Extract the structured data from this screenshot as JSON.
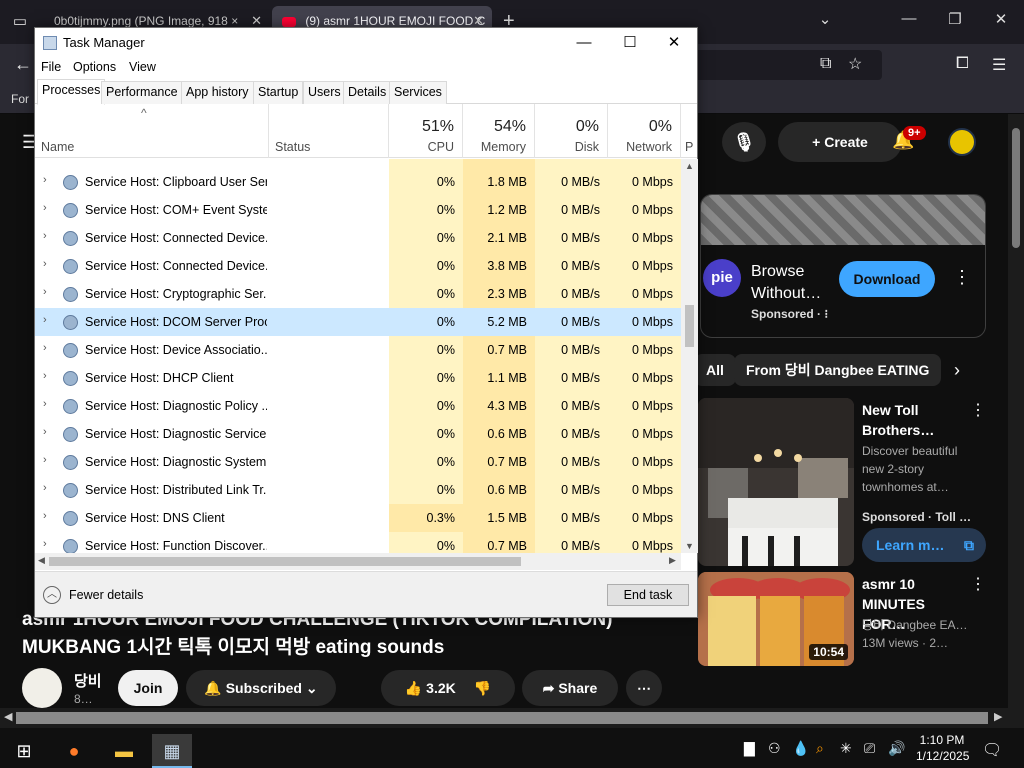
{
  "browser": {
    "tabs": [
      {
        "label": "0b0tijmmy.png (PNG Image, 918 ×"
      },
      {
        "label": "(9) asmr 1HOUR EMOJI FOOD C"
      }
    ],
    "new_tab_icon": "plus-icon",
    "bookmark_label": "For"
  },
  "youtube": {
    "create_label": "Create",
    "notification_count": "9+",
    "ad": {
      "logo_text": "pie",
      "title": "Browse Without…",
      "sponsored": "Sponsored · ⁝",
      "download_label": "Download"
    },
    "chips": [
      "All",
      "From 당비 Dangbee EATING"
    ],
    "recommendations": [
      {
        "title": "New Toll Brothers…",
        "description": "Discover beautiful new 2-story townhomes at…",
        "meta": "Sponsored · Toll …",
        "cta": "Learn m…"
      },
      {
        "title": "asmr 10 MINUTES FOR…",
        "channel": "당비 Dangbee EA…",
        "meta": "13M views · 2…",
        "duration": "10:54"
      }
    ],
    "video": {
      "title_line1": "asmr 1HOUR EMOJI FOOD CHALLENGE (TIKTOK COMPILATION)",
      "title_line2": "MUKBANG 1시간 틱톡 이모지 먹방 eating sounds",
      "channel_name": "당비",
      "subscribers": "8…",
      "join_label": "Join",
      "subscribed_label": "Subscribed",
      "likes": "3.2K",
      "share_label": "Share"
    }
  },
  "taskbar": {
    "time": "1:10 PM",
    "date": "1/12/2025"
  },
  "taskmgr": {
    "title": "Task Manager",
    "menu": [
      "File",
      "Options",
      "View"
    ],
    "tabs": [
      "Processes",
      "Performance",
      "App history",
      "Startup",
      "Users",
      "Details",
      "Services"
    ],
    "active_tab": "Processes",
    "columns": {
      "name": "Name",
      "status": "Status",
      "cpu_pct": "51%",
      "cpu": "CPU",
      "mem_pct": "54%",
      "mem": "Memory",
      "disk_pct": "0%",
      "disk": "Disk",
      "net_pct": "0%",
      "net": "Network",
      "extra": "P"
    },
    "rows": [
      {
        "name": "Service Host: Clipboard User Ser...",
        "cpu": "0%",
        "mem": "1.8 MB",
        "disk": "0 MB/s",
        "net": "0 Mbps"
      },
      {
        "name": "Service Host: COM+ Event Syste...",
        "cpu": "0%",
        "mem": "1.2 MB",
        "disk": "0 MB/s",
        "net": "0 Mbps"
      },
      {
        "name": "Service Host: Connected Device...",
        "cpu": "0%",
        "mem": "2.1 MB",
        "disk": "0 MB/s",
        "net": "0 Mbps"
      },
      {
        "name": "Service Host: Connected Device...",
        "cpu": "0%",
        "mem": "3.8 MB",
        "disk": "0 MB/s",
        "net": "0 Mbps"
      },
      {
        "name": "Service Host: Cryptographic Ser...",
        "cpu": "0%",
        "mem": "2.3 MB",
        "disk": "0 MB/s",
        "net": "0 Mbps"
      },
      {
        "name": "Service Host: DCOM Server Proc...",
        "cpu": "0%",
        "mem": "5.2 MB",
        "disk": "0 MB/s",
        "net": "0 Mbps"
      },
      {
        "name": "Service Host: Device Associatio...",
        "cpu": "0%",
        "mem": "0.7 MB",
        "disk": "0 MB/s",
        "net": "0 Mbps"
      },
      {
        "name": "Service Host: DHCP Client",
        "cpu": "0%",
        "mem": "1.1 MB",
        "disk": "0 MB/s",
        "net": "0 Mbps"
      },
      {
        "name": "Service Host: Diagnostic Policy ...",
        "cpu": "0%",
        "mem": "4.3 MB",
        "disk": "0 MB/s",
        "net": "0 Mbps"
      },
      {
        "name": "Service Host: Diagnostic Service...",
        "cpu": "0%",
        "mem": "0.6 MB",
        "disk": "0 MB/s",
        "net": "0 Mbps"
      },
      {
        "name": "Service Host: Diagnostic System...",
        "cpu": "0%",
        "mem": "0.7 MB",
        "disk": "0 MB/s",
        "net": "0 Mbps"
      },
      {
        "name": "Service Host: Distributed Link Tr...",
        "cpu": "0%",
        "mem": "0.6 MB",
        "disk": "0 MB/s",
        "net": "0 Mbps"
      },
      {
        "name": "Service Host: DNS Client",
        "cpu": "0.3%",
        "mem": "1.5 MB",
        "disk": "0 MB/s",
        "net": "0 Mbps"
      },
      {
        "name": "Service Host: Function Discover...",
        "cpu": "0%",
        "mem": "0.7 MB",
        "disk": "0 MB/s",
        "net": "0 Mbps"
      }
    ],
    "selected_row": 5,
    "footer": {
      "fewer_details": "Fewer details",
      "end_task": "End task"
    }
  }
}
